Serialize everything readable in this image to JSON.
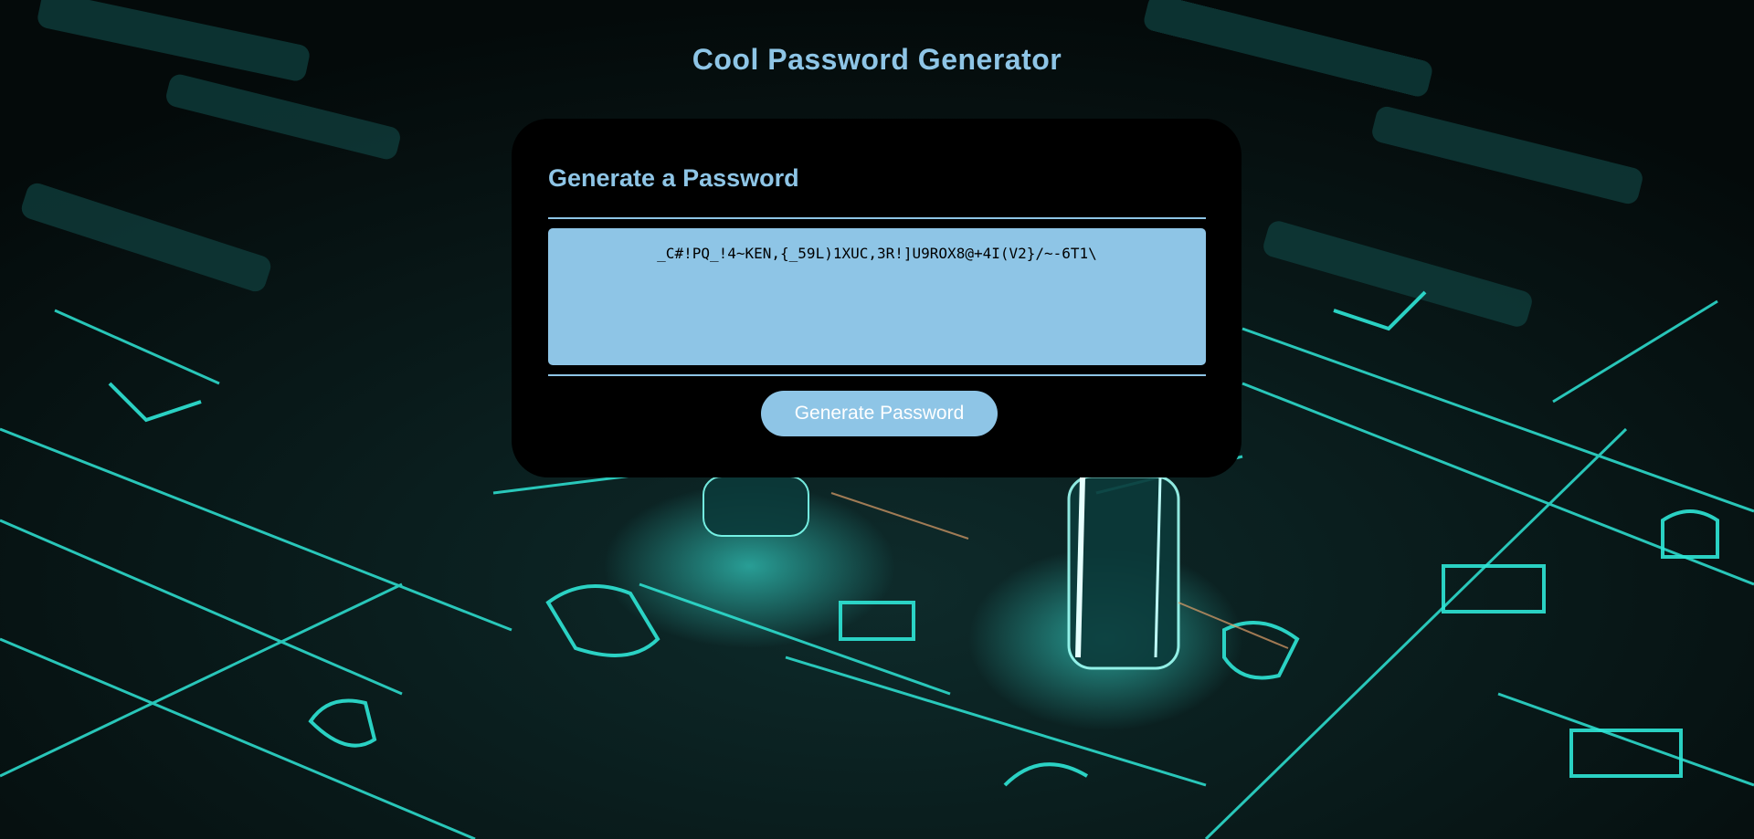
{
  "page": {
    "title": "Cool Password Generator"
  },
  "card": {
    "header": "Generate a Password",
    "password_value": "_C#!PQ_!4~KEN,{_59L)1XUC,3R!]U9ROX8@+4I(V2}/~-6T1\\",
    "password_placeholder": "",
    "generate_button_label": "Generate Password"
  },
  "colors": {
    "accent": "#8ec5e6",
    "card_background": "#000000",
    "background_glow": "#19e6d2"
  },
  "icons": {
    "background": "circuit-keyboard-background"
  }
}
